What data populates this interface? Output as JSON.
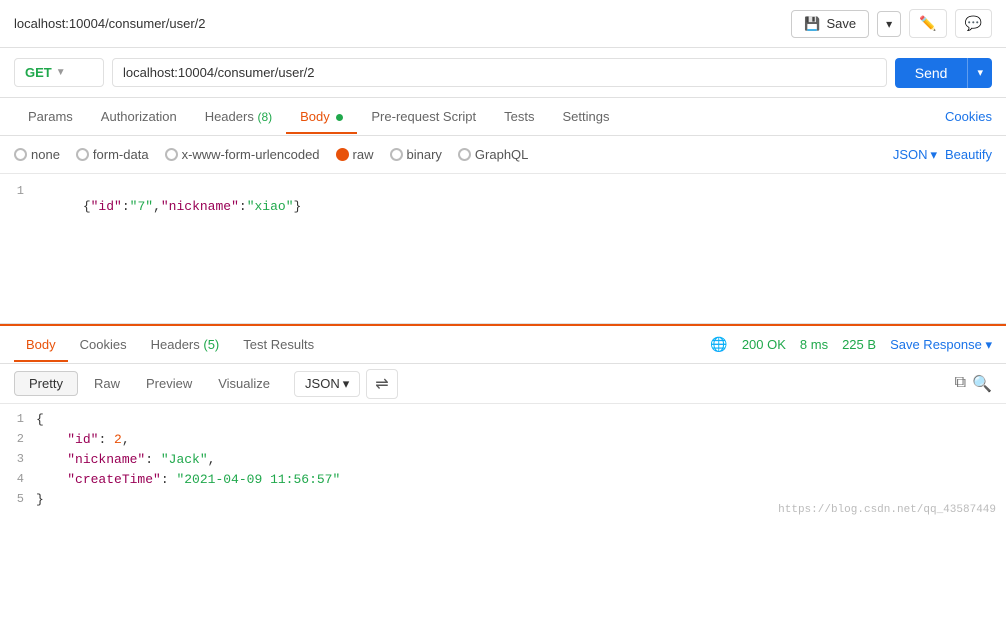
{
  "topbar": {
    "url": "localhost:10004/consumer/user/2",
    "save_label": "Save"
  },
  "request": {
    "method": "GET",
    "url": "localhost:10004/consumer/user/2",
    "send_label": "Send"
  },
  "tabs": {
    "params": "Params",
    "authorization": "Authorization",
    "headers": "Headers",
    "headers_count": "(8)",
    "body": "Body",
    "prerequest": "Pre-request Script",
    "tests": "Tests",
    "settings": "Settings",
    "cookies": "Cookies"
  },
  "body_types": {
    "none": "none",
    "form_data": "form-data",
    "urlencoded": "x-www-form-urlencoded",
    "raw": "raw",
    "binary": "binary",
    "graphql": "GraphQL",
    "json": "JSON",
    "beautify": "Beautify"
  },
  "request_body": {
    "line1": "{\"id\":\"7\",\"nickname\":\"xiao\"}"
  },
  "response": {
    "tabs": {
      "body": "Body",
      "cookies": "Cookies",
      "headers": "Headers",
      "headers_count": "(5)",
      "test_results": "Test Results"
    },
    "status": "200 OK",
    "time": "8 ms",
    "size": "225 B",
    "save_response": "Save Response",
    "formats": {
      "pretty": "Pretty",
      "raw": "Raw",
      "preview": "Preview",
      "visualize": "Visualize",
      "json": "JSON"
    },
    "lines": [
      {
        "num": 1,
        "content": "{"
      },
      {
        "num": 2,
        "content": "    \"id\": 2,"
      },
      {
        "num": 3,
        "content": "    \"nickname\": \"Jack\","
      },
      {
        "num": 4,
        "content": "    \"createTime\": \"2021-04-09 11:56:57\""
      },
      {
        "num": 5,
        "content": "}"
      }
    ],
    "watermark": "https://blog.csdn.net/qq_43587449"
  }
}
